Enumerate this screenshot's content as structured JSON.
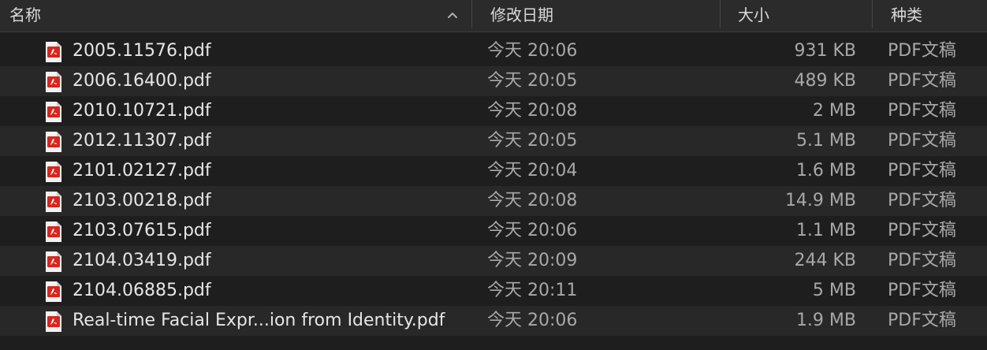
{
  "columns": {
    "name": "名称",
    "date": "修改日期",
    "size": "大小",
    "kind": "种类"
  },
  "files": [
    {
      "name": "2005.11576.pdf",
      "date": "今天 20:06",
      "size": "931 KB",
      "kind": "PDF文稿"
    },
    {
      "name": "2006.16400.pdf",
      "date": "今天 20:05",
      "size": "489 KB",
      "kind": "PDF文稿"
    },
    {
      "name": "2010.10721.pdf",
      "date": "今天 20:08",
      "size": "2 MB",
      "kind": "PDF文稿"
    },
    {
      "name": "2012.11307.pdf",
      "date": "今天 20:05",
      "size": "5.1 MB",
      "kind": "PDF文稿"
    },
    {
      "name": "2101.02127.pdf",
      "date": "今天 20:04",
      "size": "1.6 MB",
      "kind": "PDF文稿"
    },
    {
      "name": "2103.00218.pdf",
      "date": "今天 20:08",
      "size": "14.9 MB",
      "kind": "PDF文稿"
    },
    {
      "name": "2103.07615.pdf",
      "date": "今天 20:06",
      "size": "1.1 MB",
      "kind": "PDF文稿"
    },
    {
      "name": "2104.03419.pdf",
      "date": "今天 20:09",
      "size": "244 KB",
      "kind": "PDF文稿"
    },
    {
      "name": "2104.06885.pdf",
      "date": "今天 20:11",
      "size": "5 MB",
      "kind": "PDF文稿"
    },
    {
      "name": "Real-time Facial Expr...ion from Identity.pdf",
      "date": "今天 20:06",
      "size": "1.9 MB",
      "kind": "PDF文稿"
    }
  ],
  "colors": {
    "pdf_icon_red": "#d7261e",
    "row_alt": "#282828",
    "background": "#1e1e1e"
  },
  "icons": {
    "sort": "chevron-up-icon",
    "file": "pdf-file-icon"
  }
}
